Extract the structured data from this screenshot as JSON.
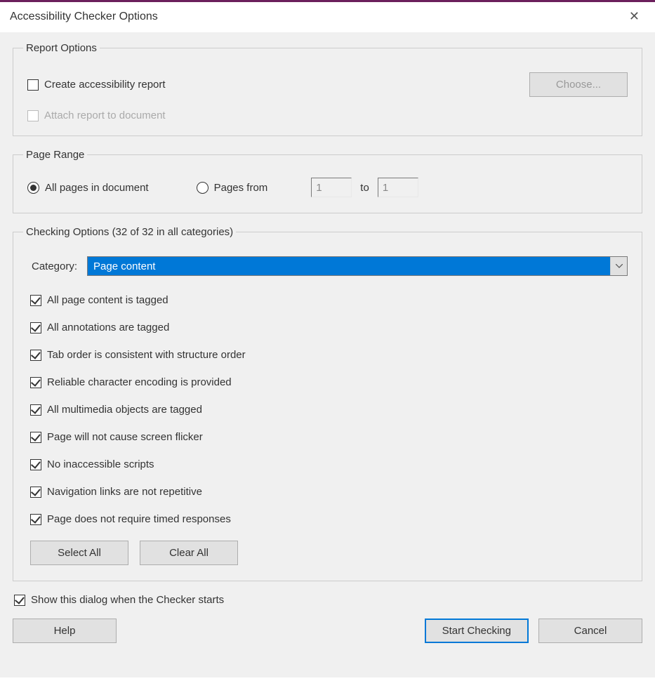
{
  "title": "Accessibility Checker Options",
  "reportOptions": {
    "legend": "Report Options",
    "createReport": {
      "label": "Create accessibility report",
      "checked": false
    },
    "attachReport": {
      "label": "Attach report to document",
      "checked": false,
      "disabled": true
    },
    "chooseBtn": "Choose..."
  },
  "pageRange": {
    "legend": "Page Range",
    "allPages": {
      "label": "All pages in document",
      "selected": true
    },
    "pagesFrom": {
      "label": "Pages from",
      "selected": false
    },
    "fromValue": "1",
    "toLabel": "to",
    "toValue": "1"
  },
  "checkingOptions": {
    "legend": "Checking Options (32 of 32 in all categories)",
    "categoryLabel": "Category:",
    "categoryValue": "Page content",
    "checks": [
      {
        "label": "All page content is tagged",
        "checked": true
      },
      {
        "label": "All annotations are tagged",
        "checked": true
      },
      {
        "label": "Tab order is consistent with structure order",
        "checked": true
      },
      {
        "label": "Reliable character encoding is provided",
        "checked": true
      },
      {
        "label": "All multimedia objects are tagged",
        "checked": true
      },
      {
        "label": "Page will not cause screen flicker",
        "checked": true
      },
      {
        "label": "No inaccessible scripts",
        "checked": true
      },
      {
        "label": "Navigation links are not repetitive",
        "checked": true
      },
      {
        "label": "Page does not require timed responses",
        "checked": true
      }
    ],
    "selectAll": "Select All",
    "clearAll": "Clear All"
  },
  "showDialog": {
    "label": "Show this dialog when the Checker starts",
    "checked": true
  },
  "footer": {
    "help": "Help",
    "start": "Start Checking",
    "cancel": "Cancel"
  }
}
